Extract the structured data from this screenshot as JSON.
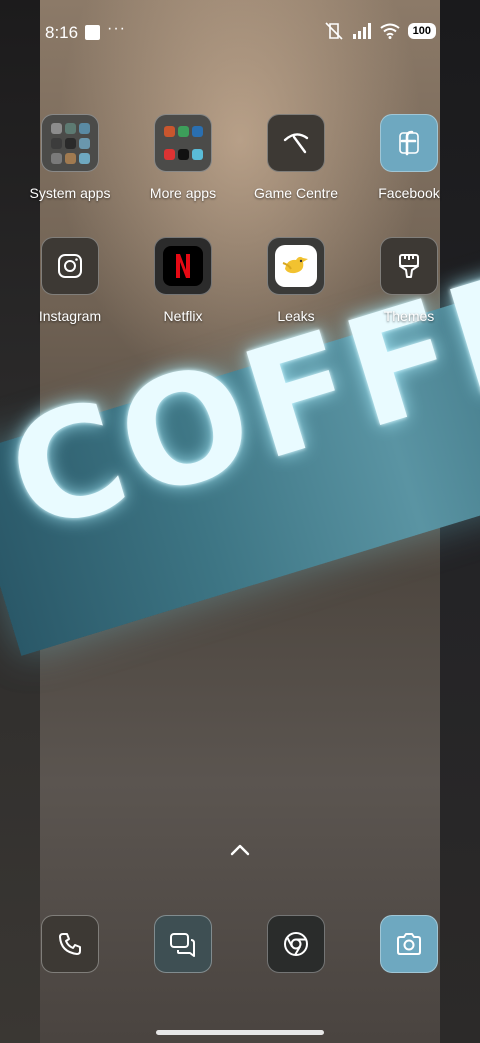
{
  "status_bar": {
    "time": "8:16",
    "more_indicator": "···",
    "battery": "100",
    "icons": [
      "mute-vibrate-icon",
      "signal-icon",
      "wifi-icon",
      "battery-icon"
    ]
  },
  "apps": [
    {
      "label": "System apps",
      "icon": "folder-icon"
    },
    {
      "label": "More apps",
      "icon": "folder-icon"
    },
    {
      "label": "Game Centre",
      "icon": "game-centre-icon"
    },
    {
      "label": "Facebook",
      "icon": "facebook-icon"
    },
    {
      "label": "Instagram",
      "icon": "instagram-icon"
    },
    {
      "label": "Netflix",
      "icon": "netflix-icon"
    },
    {
      "label": "Leaks",
      "icon": "leaks-bird-icon"
    },
    {
      "label": "Themes",
      "icon": "paintbrush-icon"
    }
  ],
  "dock": [
    {
      "icon": "phone-icon"
    },
    {
      "icon": "messages-icon"
    },
    {
      "icon": "chrome-icon"
    },
    {
      "icon": "camera-icon"
    }
  ],
  "wallpaper_text": "COFFEE",
  "colors": {
    "dock_teal": "#6ea8c0",
    "icon_dark": "#3d3934",
    "netflix_red": "#e50914"
  }
}
